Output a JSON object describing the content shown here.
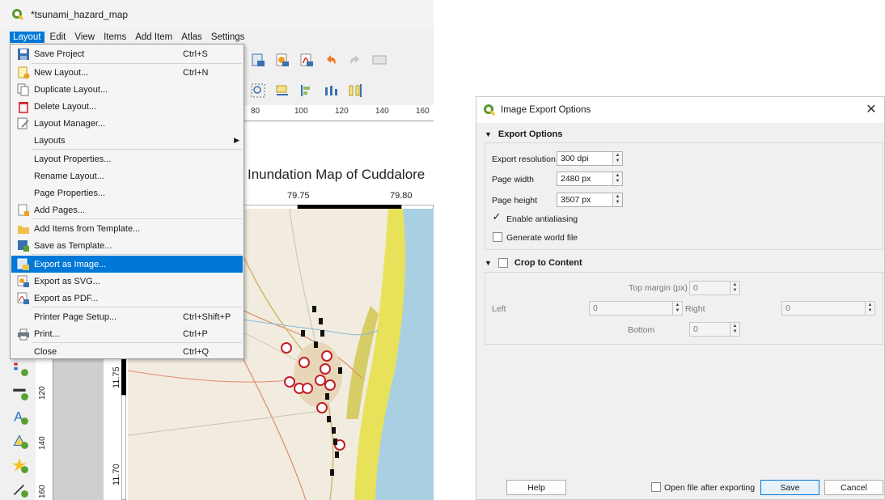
{
  "window": {
    "title": "*tsunami_hazard_map",
    "menubar": [
      "Layout",
      "Edit",
      "View",
      "Items",
      "Add Item",
      "Atlas",
      "Settings"
    ]
  },
  "layout_menu": {
    "items": [
      {
        "label": "Save Project",
        "shortcut": "Ctrl+S",
        "icon": "save-icon"
      },
      {
        "label": "New Layout...",
        "shortcut": "Ctrl+N",
        "icon": "new-layout-icon"
      },
      {
        "label": "Duplicate Layout...",
        "shortcut": "",
        "icon": "duplicate-icon"
      },
      {
        "label": "Delete Layout...",
        "shortcut": "",
        "icon": "trash-icon"
      },
      {
        "label": "Layout Manager...",
        "shortcut": "",
        "icon": "layout-manager-icon"
      },
      {
        "label": "Layouts",
        "shortcut": "",
        "icon": ""
      },
      {
        "label": "Layout Properties...",
        "shortcut": "",
        "icon": ""
      },
      {
        "label": "Rename Layout...",
        "shortcut": "",
        "icon": ""
      },
      {
        "label": "Page Properties...",
        "shortcut": "",
        "icon": ""
      },
      {
        "label": "Add Pages...",
        "shortcut": "",
        "icon": "add-page-icon"
      },
      {
        "label": "Add Items from Template...",
        "shortcut": "",
        "icon": "folder-icon"
      },
      {
        "label": "Save as Template...",
        "shortcut": "",
        "icon": "save-template-icon"
      },
      {
        "label": "Export as Image...",
        "shortcut": "",
        "icon": "export-image-icon"
      },
      {
        "label": "Export as SVG...",
        "shortcut": "",
        "icon": "export-svg-icon"
      },
      {
        "label": "Export as PDF...",
        "shortcut": "",
        "icon": "export-pdf-icon"
      },
      {
        "label": "Printer Page Setup...",
        "shortcut": "Ctrl+Shift+P",
        "icon": ""
      },
      {
        "label": "Print...",
        "shortcut": "Ctrl+P",
        "icon": "printer-icon"
      },
      {
        "label": "Close",
        "shortcut": "Ctrl+Q",
        "icon": ""
      }
    ],
    "highlighted": "Export as Image..."
  },
  "ruler": {
    "top_labels": [
      "80",
      "100",
      "120",
      "140",
      "160"
    ],
    "left_labels": [
      "120",
      "140",
      "160"
    ]
  },
  "map": {
    "title": "Inundation Map of Cuddalore",
    "top_coords": [
      "79.75",
      "79.80"
    ],
    "left_coords": [
      "11.75",
      "11.70"
    ]
  },
  "dialog": {
    "title": "Image Export Options",
    "export_section": "Export Options",
    "export_resolution_label": "Export resolution",
    "export_resolution_value": "300 dpi",
    "page_width_label": "Page width",
    "page_width_value": "2480 px",
    "page_height_label": "Page height",
    "page_height_value": "3507 px",
    "antialiasing_label": "Enable antialiasing",
    "world_file_label": "Generate world file",
    "crop_section": "Crop to Content",
    "top_margin_label": "Top margin (px)",
    "top_margin_value": "0",
    "left_label": "Left",
    "left_value": "0",
    "right_label": "Right",
    "right_value": "0",
    "bottom_label": "Bottom",
    "bottom_value": "0",
    "help_label": "Help",
    "open_file_label": "Open file after exporting",
    "save_label": "Save",
    "cancel_label": "Cancel"
  },
  "colors": {
    "accent": "#0078d7",
    "qgis_green": "#589632",
    "coast_yellow": "#e8e25a",
    "sea_blue": "#a9cfe3"
  }
}
